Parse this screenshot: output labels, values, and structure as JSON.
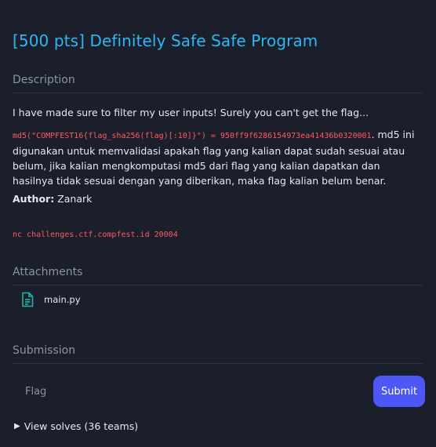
{
  "challenge": {
    "title": "[500 pts] Definitely Safe Safe Program"
  },
  "description": {
    "heading": "Description",
    "intro": "I have made sure to filter my user inputs! Surely you can't get the flag...",
    "md5_code": "md5(\"COMPFEST16{flag_sha256(flag)[:10]}\") = 950ff9f6286154973ea41436b0320001",
    "md5_text": ". md5 ini digunakan untuk memvalidasi apakah flag yang kalian dapat sudah sesuai atau belum, jika kalian mengkomputasi md5 dari flag yang kalian dapatkan dan hasilnya tidak sesuai dengan yang diberikan, maka flag kalian belum benar.",
    "author_label": "Author:",
    "author_name": " Zanark",
    "connection": "nc challenges.ctf.compfest.id 20004"
  },
  "attachments": {
    "heading": "Attachments",
    "files": [
      {
        "name": "main.py",
        "icon": "file-icon"
      }
    ]
  },
  "submission": {
    "heading": "Submission",
    "input_placeholder": "Flag",
    "input_value": "",
    "submit_label": "Submit"
  },
  "solves": {
    "label": "View solves (36 teams)",
    "icon": "triangle-right-icon"
  },
  "colors": {
    "background": "#1b1f2b",
    "title": "#2eb7f0",
    "section_heading": "#8a93a8",
    "code_red": "#ff5a5f",
    "submit_button": "#4d57f6",
    "file_icon": "#1fb7a3"
  }
}
